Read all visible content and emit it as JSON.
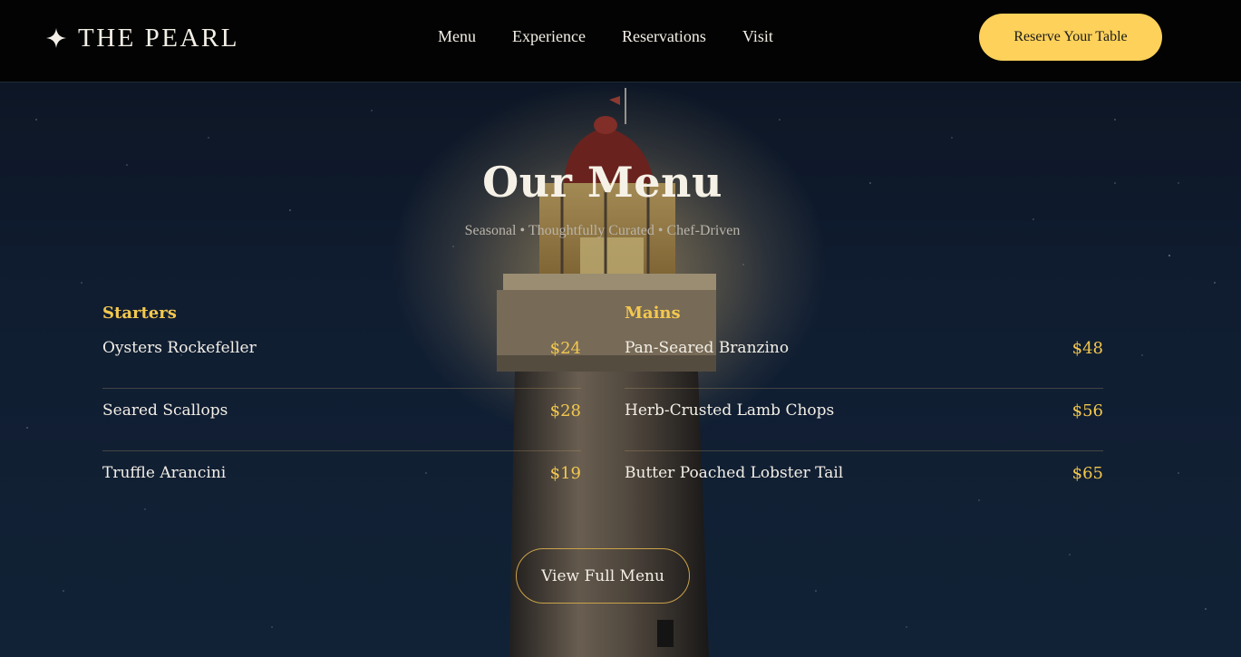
{
  "header": {
    "brand_icon": "sparkle-star-icon",
    "brand_name": "THE PEARL",
    "nav": [
      "Menu",
      "Experience",
      "Reservations",
      "Visit"
    ],
    "cta_label": "Reserve Your Table"
  },
  "hero": {
    "background": "lighthouse-night-sky-photo",
    "title": "Our Menu",
    "tagline": "Seasonal • Thoughtfully Curated • Chef-Driven",
    "sections": [
      {
        "heading": "Starters",
        "items": [
          {
            "name": "Oysters Rockefeller",
            "price": "$24"
          },
          {
            "name": "Seared Scallops",
            "price": "$28"
          },
          {
            "name": "Truffle Arancini",
            "price": "$19"
          }
        ]
      },
      {
        "heading": "Mains",
        "items": [
          {
            "name": "Pan-Seared Branzino",
            "price": "$48"
          },
          {
            "name": "Herb-Crusted Lamb Chops",
            "price": "$56"
          },
          {
            "name": "Butter Poached Lobster Tail",
            "price": "$65"
          }
        ]
      }
    ],
    "full_menu_label": "View Full Menu"
  },
  "colors": {
    "accent": "#fdd15a",
    "gold_text": "#f3c84e",
    "header_bg": "#030303",
    "night_sky": "#13233a"
  }
}
